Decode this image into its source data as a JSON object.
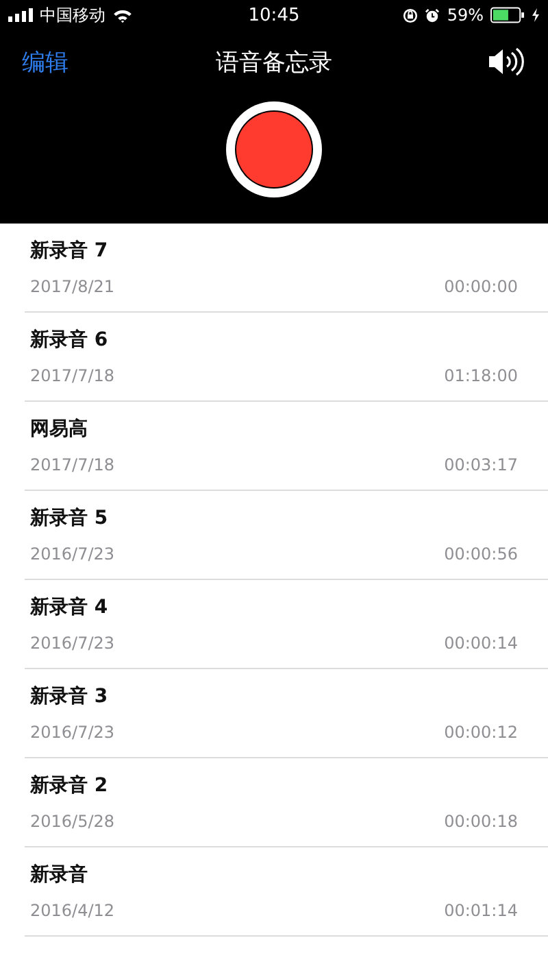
{
  "status_bar": {
    "carrier": "中国移动",
    "time": "10:45",
    "battery_percent": "59%"
  },
  "nav_bar": {
    "edit": "编辑",
    "title": "语音备忘录"
  },
  "recordings": [
    {
      "name": "新录音 7",
      "date": "2017/8/21",
      "duration": "00:00:00"
    },
    {
      "name": "新录音 6",
      "date": "2017/7/18",
      "duration": "01:18:00"
    },
    {
      "name": "网易高",
      "date": "2017/7/18",
      "duration": "00:03:17"
    },
    {
      "name": "新录音 5",
      "date": "2016/7/23",
      "duration": "00:00:56"
    },
    {
      "name": "新录音 4",
      "date": "2016/7/23",
      "duration": "00:00:14"
    },
    {
      "name": "新录音 3",
      "date": "2016/7/23",
      "duration": "00:00:12"
    },
    {
      "name": "新录音 2",
      "date": "2016/5/28",
      "duration": "00:00:18"
    },
    {
      "name": "新录音",
      "date": "2016/4/12",
      "duration": "00:01:14"
    }
  ]
}
